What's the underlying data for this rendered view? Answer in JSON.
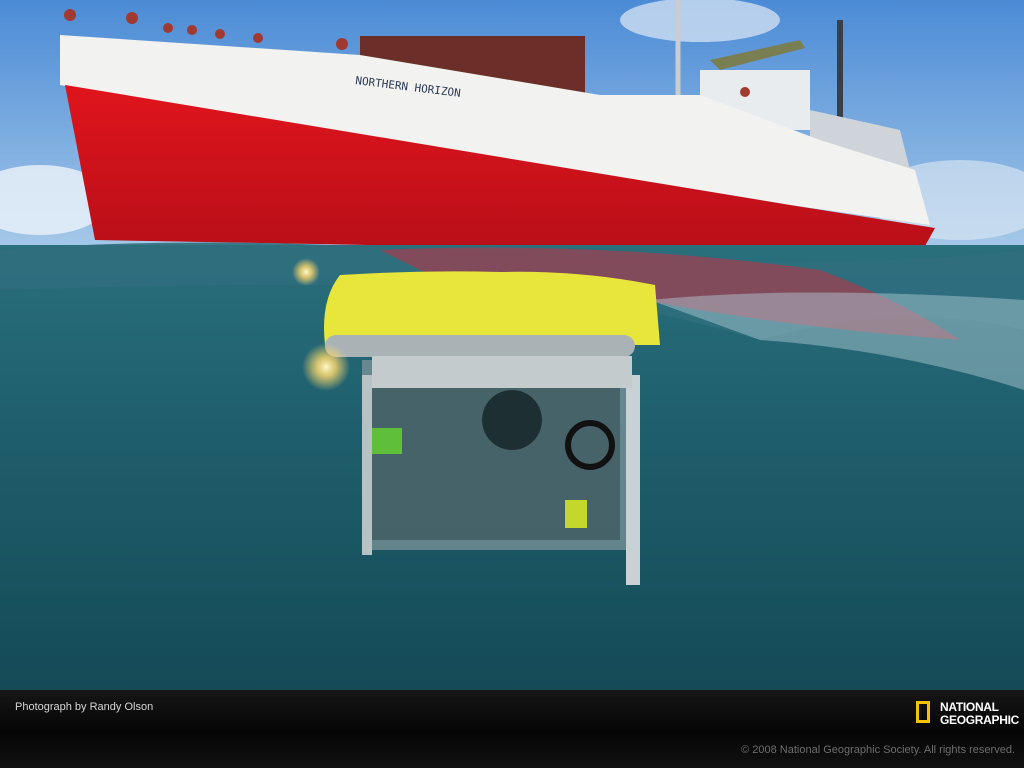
{
  "photo": {
    "ship_name": "NORTHERN HORIZON"
  },
  "footer": {
    "credit": "Photograph by Randy Olson",
    "copyright": "© 2008 National Geographic Society. All rights reserved.",
    "logo_line1": "NATIONAL",
    "logo_line2": "GEOGRAPHIC"
  },
  "colors": {
    "hull_red": "#d8141c",
    "water": "#1f5f6d",
    "rov_yellow": "#e8e63a",
    "logo_yellow": "#f5c400"
  }
}
